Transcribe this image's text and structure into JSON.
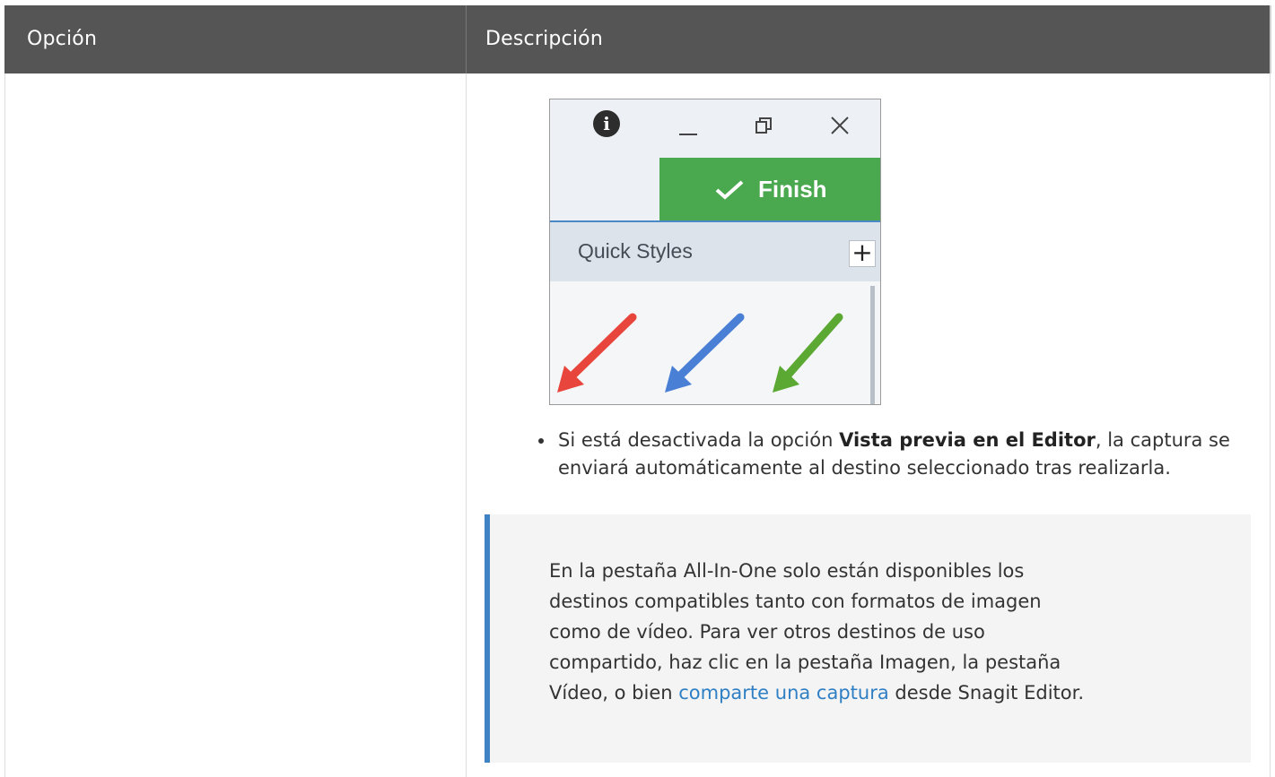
{
  "table": {
    "headers": [
      "Opción",
      "Descripción"
    ]
  },
  "screenshot": {
    "finish_label": "Finish",
    "quick_styles_label": "Quick Styles",
    "plus_label": "+",
    "icons": [
      "info-icon",
      "minimize-icon",
      "restore-icon",
      "close-icon",
      "checkmark-icon",
      "plus-icon"
    ],
    "arrow_colors": [
      "#e8453c",
      "#4a7fd6",
      "#5ba832"
    ],
    "finish_color": "#4aa84f"
  },
  "bullet": {
    "prefix": "Si está desactivada la opción ",
    "bold": "Vista previa en el Editor",
    "suffix": ", la captura se enviará automáticamente al destino seleccionado tras realizarla."
  },
  "note": {
    "text_before": "En la pestaña All-In-One solo están disponibles los destinos compatibles tanto con formatos de imagen como de vídeo. Para ver otros destinos de uso compartido, haz clic en la pestaña Imagen, la pestaña Vídeo, o bien ",
    "link_text": "comparte una captura",
    "text_after": " desde Snagit Editor.",
    "accent_color": "#3f83c4",
    "link_color": "#2f7fc4"
  }
}
